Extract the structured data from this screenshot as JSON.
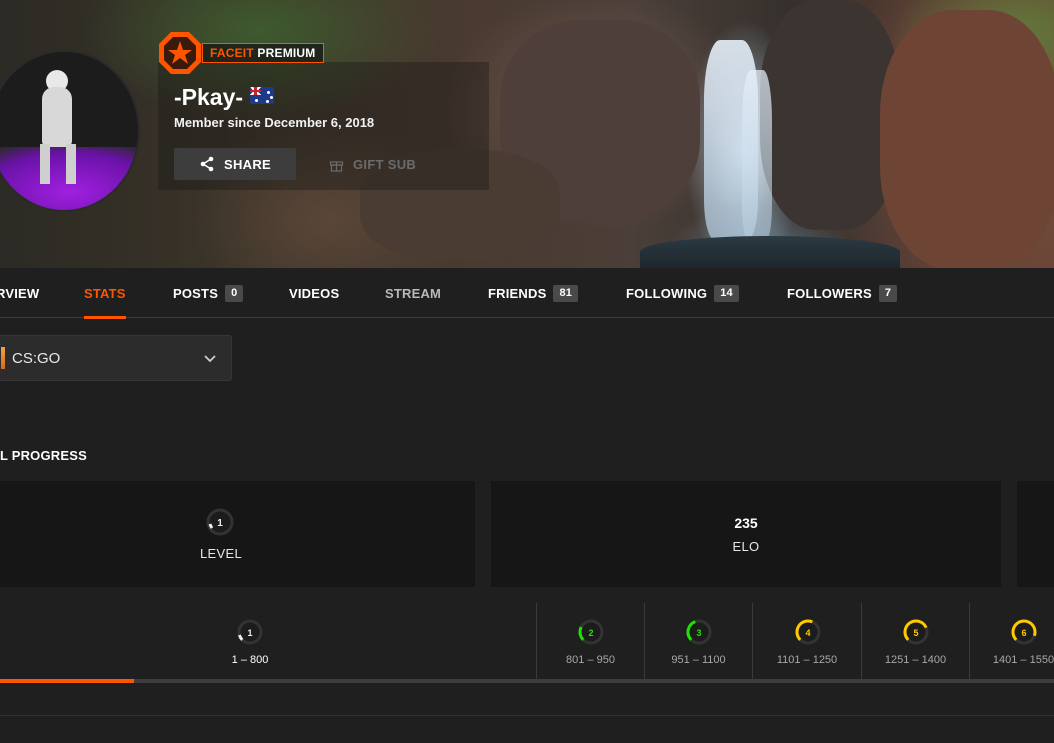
{
  "profile": {
    "premium_brand": "FACEIT",
    "premium_tier": "PREMIUM",
    "username": "-Pkay-",
    "country_flag": "Australia",
    "member_since": "Member since December 6, 2018",
    "share_label": "SHARE",
    "gift_label": "GIFT SUB"
  },
  "tabs": [
    {
      "label": "RVIEW"
    },
    {
      "label": "STATS",
      "active": true
    },
    {
      "label": "POSTS",
      "count": "0"
    },
    {
      "label": "VIDEOS"
    },
    {
      "label": "STREAM"
    },
    {
      "label": "FRIENDS",
      "count": "81"
    },
    {
      "label": "FOLLOWING",
      "count": "14"
    },
    {
      "label": "FOLLOWERS",
      "count": "7"
    }
  ],
  "game_select": {
    "value": "CS:GO"
  },
  "progress": {
    "title": "L PROGRESS",
    "level_value": "1",
    "level_caption": "LEVEL",
    "elo_value": "235",
    "elo_caption": "ELO"
  },
  "levels": [
    {
      "level": "1",
      "range": "1 – 800",
      "color": "#eeeeee"
    },
    {
      "level": "2",
      "range": "801 – 950",
      "color": "#1ce400"
    },
    {
      "level": "3",
      "range": "951 – 1100",
      "color": "#1ce400"
    },
    {
      "level": "4",
      "range": "1101 – 1250",
      "color": "#ffc800"
    },
    {
      "level": "5",
      "range": "1251 – 1400",
      "color": "#ffc800"
    },
    {
      "level": "6",
      "range": "1401 – 1550",
      "color": "#ffc800"
    }
  ],
  "level_progress_fraction": 0.29,
  "colors": {
    "accent": "#ff5500",
    "background": "#1f1f1f",
    "card": "#161616"
  }
}
